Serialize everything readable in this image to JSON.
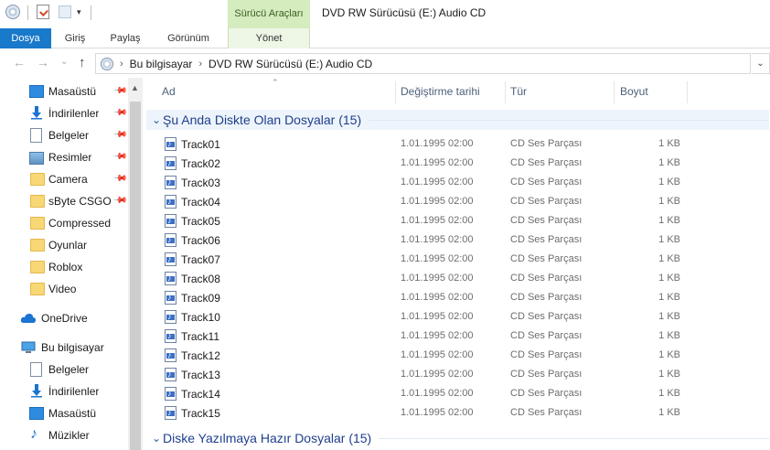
{
  "window": {
    "title": "DVD RW Sürücüsü (E:) Audio CD",
    "context_tab": "Sürücü Araçları",
    "quick_access_menu": "▾"
  },
  "ribbon": {
    "tabs": [
      "Dosya",
      "Giriş",
      "Paylaş",
      "Görünüm"
    ],
    "manage_tab": "Yönet"
  },
  "address": {
    "back": "←",
    "forward": "→",
    "recent": "⌄",
    "up": "↑",
    "crumbs": [
      "Bu bilgisayar",
      "DVD RW Sürücüsü (E:) Audio CD"
    ],
    "separator": "›",
    "dropdown": "⌄"
  },
  "nav_pane": {
    "quick_access": [
      {
        "label": "Masaüstü",
        "icon": "desktop-icon",
        "pinned": true
      },
      {
        "label": "İndirilenler",
        "icon": "downloads-icon",
        "pinned": true
      },
      {
        "label": "Belgeler",
        "icon": "documents-icon",
        "pinned": true
      },
      {
        "label": "Resimler",
        "icon": "pictures-icon",
        "pinned": true
      },
      {
        "label": "Camera",
        "icon": "folder-icon",
        "pinned": true
      },
      {
        "label": "sByte CSGO V",
        "icon": "folder-icon",
        "pinned": true
      },
      {
        "label": "Compressed",
        "icon": "folder-icon",
        "pinned": false
      },
      {
        "label": "Oyunlar",
        "icon": "folder-icon",
        "pinned": false
      },
      {
        "label": "Roblox",
        "icon": "folder-icon",
        "pinned": false
      },
      {
        "label": "Video",
        "icon": "folder-icon",
        "pinned": false
      }
    ],
    "onedrive": "OneDrive",
    "this_pc": "Bu bilgisayar",
    "this_pc_items": [
      {
        "label": "Belgeler",
        "icon": "documents-icon"
      },
      {
        "label": "İndirilenler",
        "icon": "downloads-icon"
      },
      {
        "label": "Masaüstü",
        "icon": "desktop-icon"
      },
      {
        "label": "Müzikler",
        "icon": "music-icon"
      }
    ],
    "pin_glyph": "📌",
    "scroll_up": "▲"
  },
  "columns": {
    "name": "Ad",
    "date": "Değiştirme tarihi",
    "type": "Tür",
    "size": "Boyut",
    "sort_arrow": "⌃"
  },
  "groups": [
    {
      "title": "Şu Anda Diskte Olan Dosyalar (15)",
      "chevron": "⌄"
    },
    {
      "title": "Diske Yazılmaya Hazır Dosyalar (15)",
      "chevron": "⌄"
    }
  ],
  "files": [
    {
      "name": "Track01",
      "date": "1.01.1995 02:00",
      "type": "CD Ses Parçası",
      "size": "1 KB"
    },
    {
      "name": "Track02",
      "date": "1.01.1995 02:00",
      "type": "CD Ses Parçası",
      "size": "1 KB"
    },
    {
      "name": "Track03",
      "date": "1.01.1995 02:00",
      "type": "CD Ses Parçası",
      "size": "1 KB"
    },
    {
      "name": "Track04",
      "date": "1.01.1995 02:00",
      "type": "CD Ses Parçası",
      "size": "1 KB"
    },
    {
      "name": "Track05",
      "date": "1.01.1995 02:00",
      "type": "CD Ses Parçası",
      "size": "1 KB"
    },
    {
      "name": "Track06",
      "date": "1.01.1995 02:00",
      "type": "CD Ses Parçası",
      "size": "1 KB"
    },
    {
      "name": "Track07",
      "date": "1.01.1995 02:00",
      "type": "CD Ses Parçası",
      "size": "1 KB"
    },
    {
      "name": "Track08",
      "date": "1.01.1995 02:00",
      "type": "CD Ses Parçası",
      "size": "1 KB"
    },
    {
      "name": "Track09",
      "date": "1.01.1995 02:00",
      "type": "CD Ses Parçası",
      "size": "1 KB"
    },
    {
      "name": "Track10",
      "date": "1.01.1995 02:00",
      "type": "CD Ses Parçası",
      "size": "1 KB"
    },
    {
      "name": "Track11",
      "date": "1.01.1995 02:00",
      "type": "CD Ses Parçası",
      "size": "1 KB"
    },
    {
      "name": "Track12",
      "date": "1.01.1995 02:00",
      "type": "CD Ses Parçası",
      "size": "1 KB"
    },
    {
      "name": "Track13",
      "date": "1.01.1995 02:00",
      "type": "CD Ses Parçası",
      "size": "1 KB"
    },
    {
      "name": "Track14",
      "date": "1.01.1995 02:00",
      "type": "CD Ses Parçası",
      "size": "1 KB"
    },
    {
      "name": "Track15",
      "date": "1.01.1995 02:00",
      "type": "CD Ses Parçası",
      "size": "1 KB"
    }
  ],
  "colors": {
    "file_tab": "#1979ca",
    "context_tab": "#d5ecbf",
    "group_title": "#1e3f8c"
  }
}
